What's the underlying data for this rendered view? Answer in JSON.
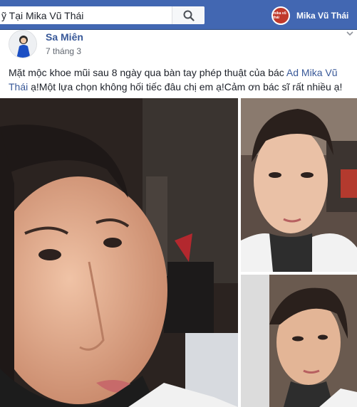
{
  "topbar": {
    "search_value": "ỹ Tại Mika Vũ Thái",
    "search_icon": "search-icon",
    "profile_name": "Mika Vũ Thái",
    "profile_avatar_text": "mika vũ thái",
    "colors": {
      "bar": "#4267b2"
    }
  },
  "post": {
    "author": "Sa Miên",
    "date": "7 tháng 3",
    "text_before": "Mặt mộc khoe mũi sau 8 ngày qua bàn tay phép thuật của bác ",
    "mention": "Ad Mika Vũ Thái",
    "text_after": " ạ!Một lựa chọn không hối tiếc đâu chị em ạ!Cảm ơn bác sĩ rất nhiều ạ!",
    "more_icon": "chevron-down-icon",
    "photos": [
      "selfie-close-up",
      "selfie-front",
      "selfie-side"
    ]
  }
}
